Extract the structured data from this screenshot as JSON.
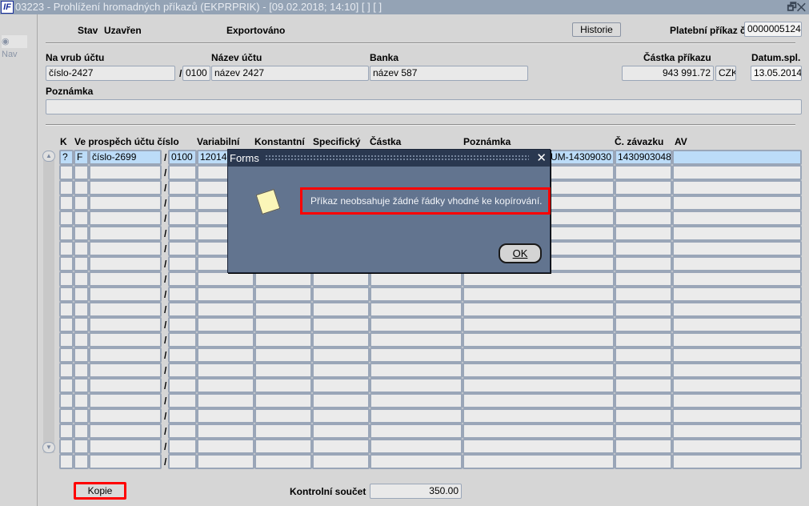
{
  "window": {
    "logo": "IF",
    "title": "03223 - Prohlížení hromadných příkazů (EKPRPRIK) - [09.02.2018; 14:10]  [ ]  [ ]",
    "controls": "🗗✕"
  },
  "nav": {
    "label": "Nav"
  },
  "header": {
    "stav_label": "Stav",
    "stav_value": "Uzavřen",
    "export_label": "Exportováno",
    "historie_button": "Historie",
    "platebni_label": "Platební příkaz č.",
    "platebni_value": "0000005124"
  },
  "account": {
    "na_vrub_label": "Na vrub účtu",
    "na_vrub_value": "číslo-2427",
    "bank_code": "0100",
    "nazev_label": "Název účtu",
    "nazev_value": "název 2427",
    "banka_label": "Banka",
    "banka_value": "název 587",
    "castka_label": "Částka příkazu",
    "castka_value": "943 991.72",
    "currency": "CZK",
    "datum_label": "Datum.spl.",
    "datum_value": "13.05.2014",
    "poznamka_label": "Poznámka",
    "poznamka_value": ""
  },
  "table": {
    "headers": {
      "k": "K",
      "ucet": "Ve prospěch účtu číslo",
      "variabilni": "Variabilní",
      "konstantni": "Konstantní",
      "specificky": "Specifický",
      "castka": "Částka",
      "poznamka": "Poznámka",
      "zavazek": "Č. závazku",
      "av": "AV"
    },
    "rows": [
      {
        "k": "?",
        "f": "F",
        "ucet": "číslo-2699",
        "banka": "0100",
        "variabilni": "120140",
        "konstantni": "",
        "specificky": "",
        "castka": "",
        "poznamka": "ZEUM-14309030",
        "zavazek": "1430903048",
        "av": ""
      }
    ],
    "total_rows": 21,
    "separator": "/"
  },
  "footer": {
    "kopie_button": "Kopie",
    "kontrolni_label": "Kontrolní součet",
    "kontrolni_value": "350.00"
  },
  "dialog": {
    "title": "Forms",
    "close": "✕",
    "message": "Příkaz neobsahuje žádné řádky vhodné ke kopírování.",
    "ok_button": "OK"
  }
}
